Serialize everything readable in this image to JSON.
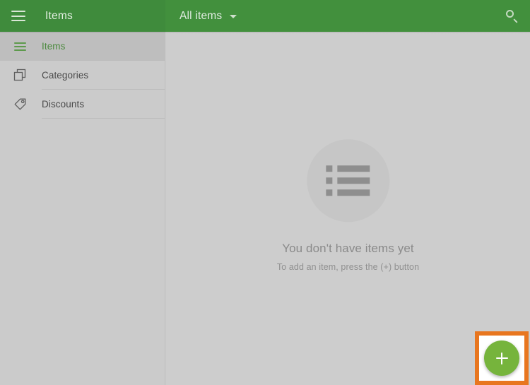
{
  "appbar": {
    "menu_icon": "hamburger-menu-icon",
    "title": "Items",
    "filter_label": "All items",
    "filter_caret_icon": "chevron-down-icon",
    "search_icon": "search-icon",
    "background_color": "#3f8b3c"
  },
  "sidebar": {
    "items": [
      {
        "label": "Items",
        "icon": "list-icon",
        "selected": true
      },
      {
        "label": "Categories",
        "icon": "copy-layers-icon",
        "selected": false
      },
      {
        "label": "Discounts",
        "icon": "tag-icon",
        "selected": false
      }
    ],
    "selected_color": "#4c8a3f",
    "background_color": "#cbcbcb"
  },
  "main": {
    "empty_state": {
      "icon": "list-placeholder-icon",
      "title": "You don't have items yet",
      "subtitle": "To add an item, press the (+) button"
    }
  },
  "fab": {
    "icon": "plus-icon",
    "color": "#76b43c",
    "highlight_color": "#e8761f"
  }
}
